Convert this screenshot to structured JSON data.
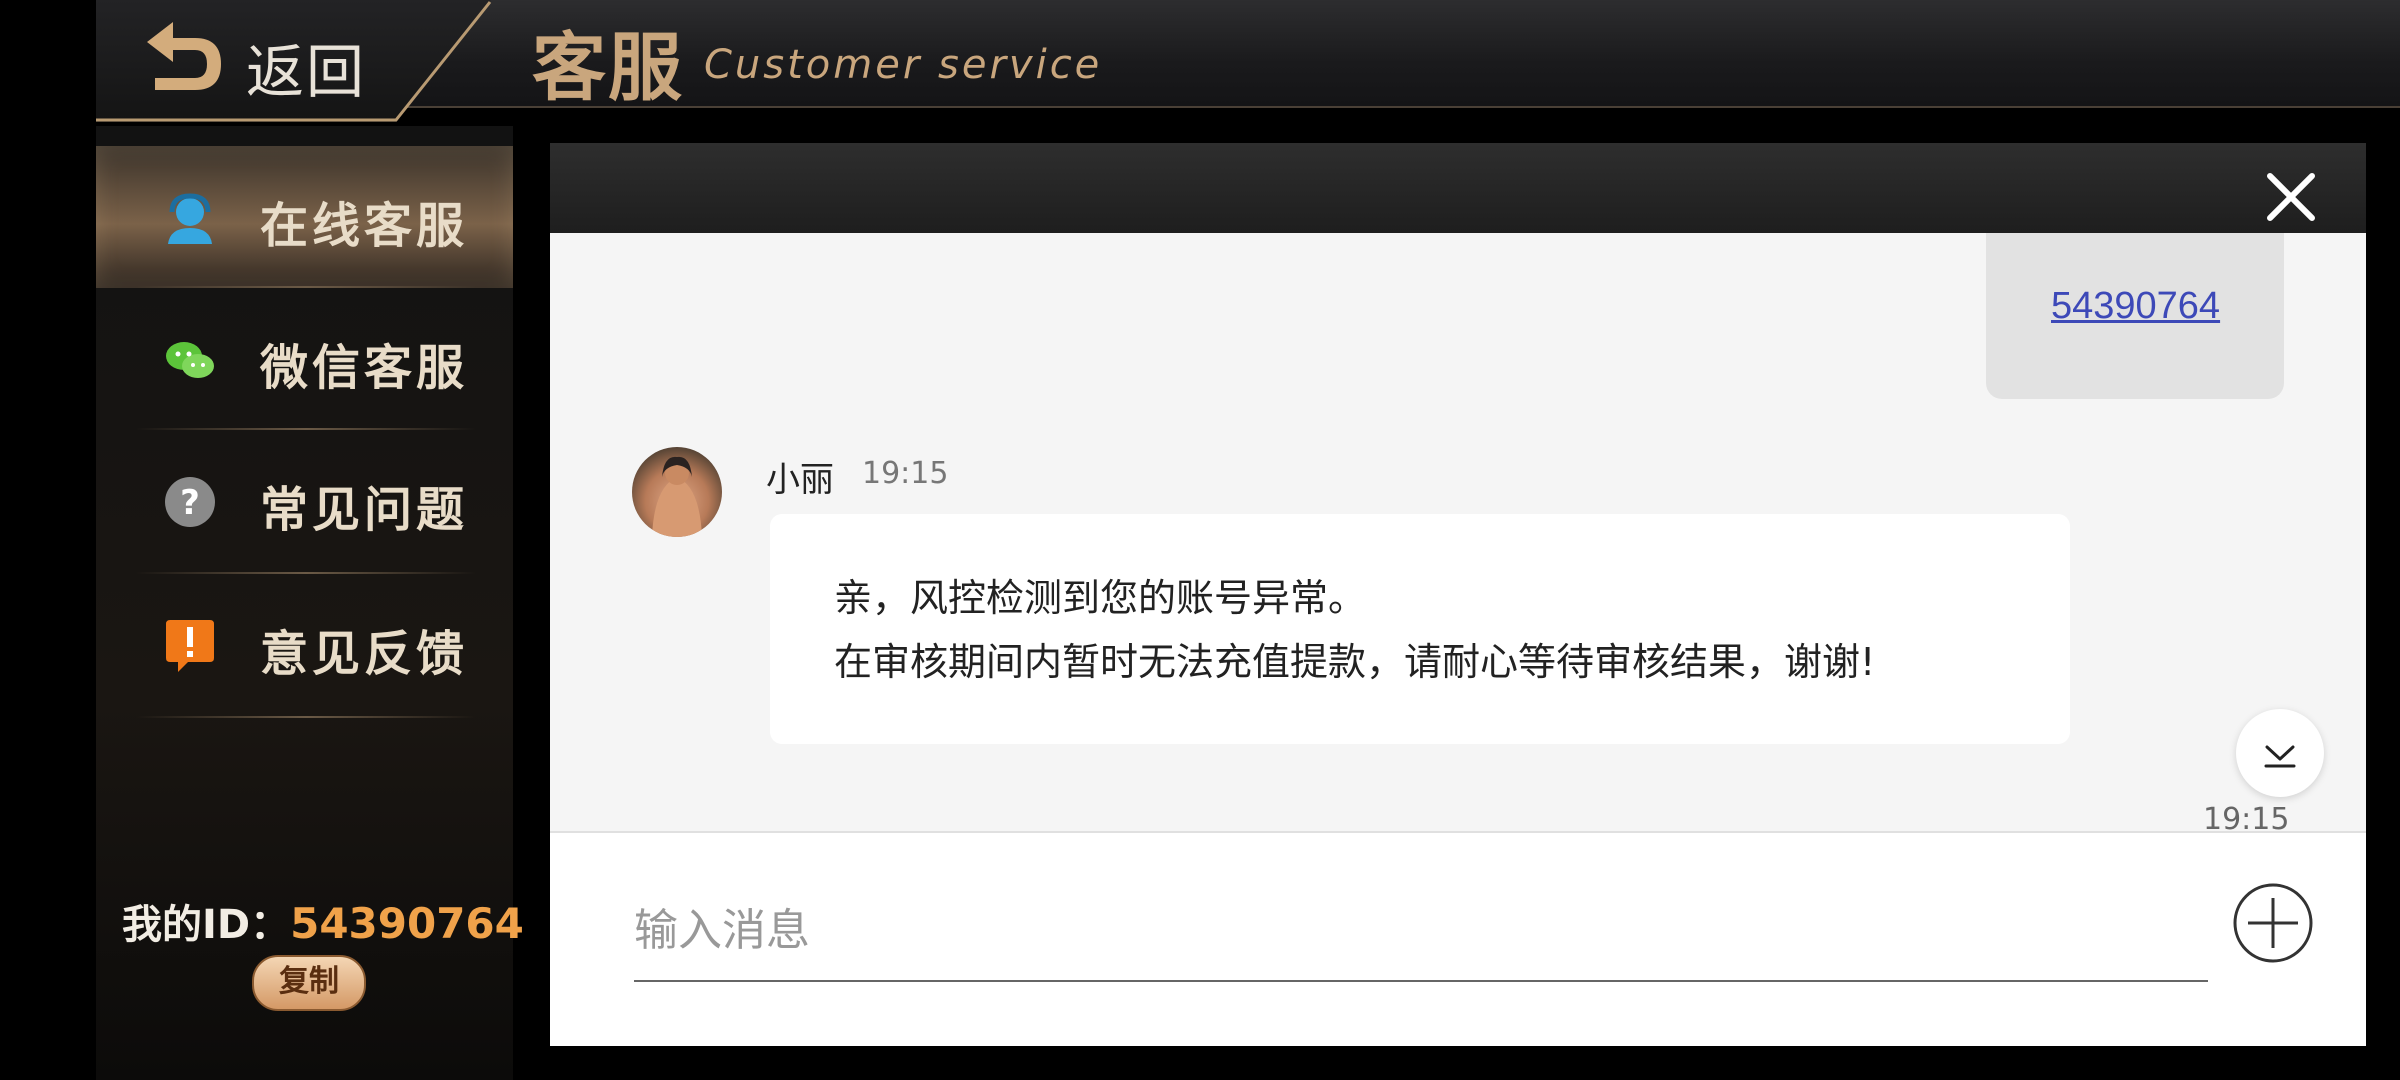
{
  "header": {
    "back_label": "返回",
    "title_cn": "客服",
    "title_en": "Customer service"
  },
  "sidebar": {
    "items": [
      {
        "label": "在线客服",
        "icon": "agent-icon",
        "active": true
      },
      {
        "label": "微信客服",
        "icon": "wechat-icon",
        "active": false
      },
      {
        "label": "常见问题",
        "icon": "question-icon",
        "active": false
      },
      {
        "label": "意见反馈",
        "icon": "feedback-icon",
        "active": false
      }
    ],
    "id_label": "我的ID：",
    "id_value": "54390764",
    "copy_label": "复制"
  },
  "chat": {
    "sent_message": "54390764",
    "sender_name": "小丽",
    "sender_time": "19:15",
    "message_line1": "亲，风控检测到您的账号异常。",
    "message_line2": "在审核期间内暂时无法充值提款，请耐心等待审核结果，谢谢!",
    "last_time": "19:15",
    "input_placeholder": "输入消息"
  },
  "colors": {
    "accent_gold": "#c9a67d",
    "id_orange": "#f0a24a",
    "link_blue": "#3d49b8"
  }
}
